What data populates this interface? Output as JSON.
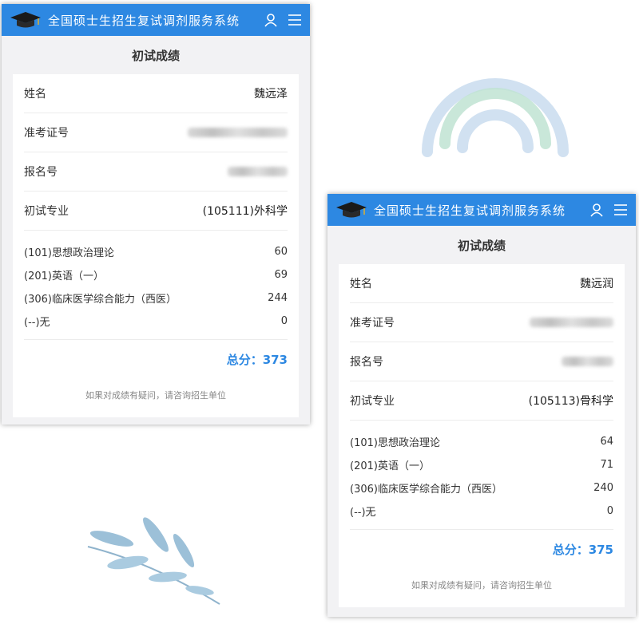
{
  "app": {
    "title": "全国硕士生招生复试调剂服务系统",
    "page_heading": "初试成绩",
    "accent_color": "#2d88e2",
    "icons": [
      "graduation-cap-icon",
      "user-icon",
      "menu-icon"
    ]
  },
  "card_a": {
    "name_label": "姓名",
    "name_value": "魏远泽",
    "exam_id_label": "准考证号",
    "reg_no_label": "报名号",
    "major_label": "初试专业",
    "major_value": "(105111)外科学",
    "subjects": [
      {
        "name": "(101)思想政治理论",
        "score": "60"
      },
      {
        "name": "(201)英语（一）",
        "score": "69"
      },
      {
        "name": "(306)临床医学综合能力（西医）",
        "score": "244"
      },
      {
        "name": "(--)无",
        "score": "0"
      }
    ],
    "total": "总分：373",
    "note": "如果对成绩有疑问，请咨询招生单位"
  },
  "card_b": {
    "name_label": "姓名",
    "name_value": "魏远润",
    "exam_id_label": "准考证号",
    "reg_no_label": "报名号",
    "major_label": "初试专业",
    "major_value": "(105113)骨科学",
    "subjects": [
      {
        "name": "(101)思想政治理论",
        "score": "64"
      },
      {
        "name": "(201)英语（一）",
        "score": "71"
      },
      {
        "name": "(306)临床医学综合能力（西医）",
        "score": "240"
      },
      {
        "name": "(--)无",
        "score": "0"
      }
    ],
    "total": "总分：375",
    "note": "如果对成绩有疑问，请咨询招生单位"
  }
}
